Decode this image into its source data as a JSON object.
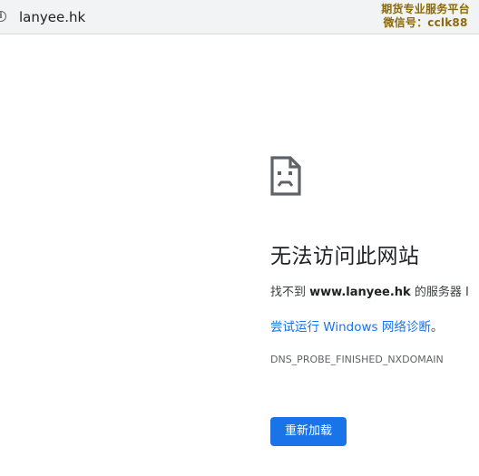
{
  "address_bar": {
    "icon": "info-icon",
    "url": "lanyee.hk"
  },
  "watermark": {
    "line1": "期货专业服务平台",
    "line2": "微信号：cclk88",
    "color": "#8a6a10"
  },
  "error": {
    "icon": "sad-file-icon",
    "title": "无法访问此网站",
    "desc_prefix": "找不到 ",
    "desc_domain": "www.lanyee.hk",
    "desc_suffix": " 的服务器 I",
    "diagnose_link": "尝试运行 Windows 网络诊断",
    "diagnose_suffix": "。",
    "code": "DNS_PROBE_FINISHED_NXDOMAIN",
    "reload_label": "重新加载"
  },
  "colors": {
    "accent": "#1a73e8",
    "address_bar_bg": "#f1f3f4",
    "text": "#202124"
  }
}
